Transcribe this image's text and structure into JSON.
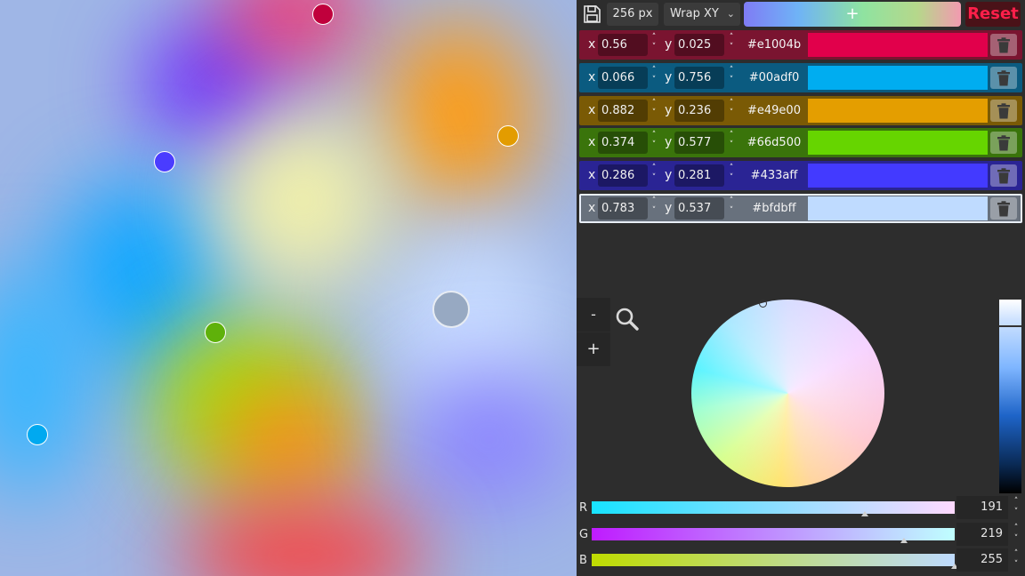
{
  "toolbar": {
    "save_icon": "save-icon",
    "size_value": "256 px",
    "wrap_mode": "Wrap XY",
    "add_label": "+",
    "reset_label": "Reset"
  },
  "points": [
    {
      "x": "0.56",
      "y": "0.025",
      "hex": "#e1004b",
      "color": "#e1004b",
      "row_bg": "#7a1430"
    },
    {
      "x": "0.066",
      "y": "0.756",
      "hex": "#00adf0",
      "color": "#00adf0",
      "row_bg": "#0b5b80"
    },
    {
      "x": "0.882",
      "y": "0.236",
      "hex": "#e49e00",
      "color": "#e49e00",
      "row_bg": "#7a5a05"
    },
    {
      "x": "0.374",
      "y": "0.577",
      "hex": "#66d500",
      "color": "#66d500",
      "row_bg": "#3a740b"
    },
    {
      "x": "0.286",
      "y": "0.281",
      "hex": "#433aff",
      "color": "#433aff",
      "row_bg": "#2a2494"
    },
    {
      "x": "0.783",
      "y": "0.537",
      "hex": "#bfdbff",
      "color": "#bfdbff",
      "row_bg": "#68717d"
    }
  ],
  "selected_index": 5,
  "zoom": {
    "out_label": "-",
    "in_label": "+",
    "icon": "magnifier-icon"
  },
  "sliders": [
    {
      "label": "R",
      "value": "191",
      "gradient": [
        "#17e3ff",
        "#ffd9ff"
      ]
    },
    {
      "label": "G",
      "value": "219",
      "gradient": [
        "#bf1bff",
        "#bfffff"
      ]
    },
    {
      "label": "B",
      "value": "255",
      "gradient": [
        "#bfdb00",
        "#bfdbff"
      ]
    }
  ],
  "icons": {
    "delete": "trash-icon",
    "spinner": "spinner-arrows-icon",
    "dropdown": "chevron-down-icon"
  }
}
